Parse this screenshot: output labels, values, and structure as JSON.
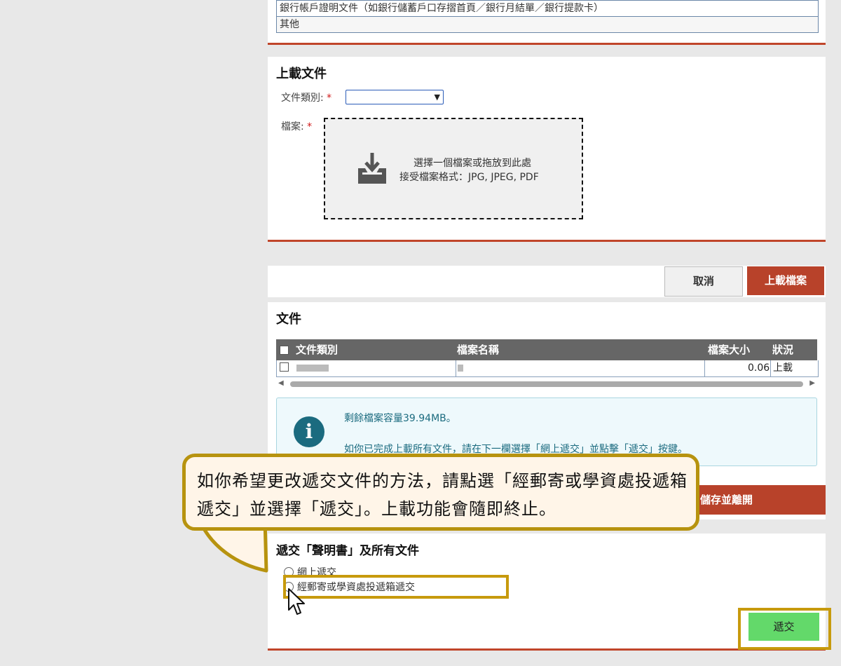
{
  "document_types": {
    "items": [
      "銀行帳戶證明文件（如銀行儲蓄戶口存摺首頁／銀行月結單／銀行提款卡）",
      "其他"
    ]
  },
  "upload": {
    "title": "上載文件",
    "type_label": "文件類別:",
    "file_label": "檔案:",
    "required_mark": "*",
    "drop_text": "選擇一個檔案或拖放到此處",
    "accept_text": "接受檔案格式：JPG, JPEG, PDF",
    "icon": "download-tray-icon"
  },
  "buttons": {
    "cancel": "取消",
    "upload": "上載檔案",
    "save_leave": "儲存並離開",
    "submit": "遞交"
  },
  "documents": {
    "title": "文件",
    "columns": [
      "文件類別",
      "檔案名稱",
      "檔案大小",
      "狀況"
    ],
    "rows": [
      {
        "type": "",
        "filename": "",
        "size": "0.06",
        "status": "上載"
      }
    ]
  },
  "info": {
    "icon": "info-icon",
    "line1": "剩餘檔案容量39.94MB。",
    "line2": "如你已完成上載所有文件，請在下一欄選擇「網上遞交」並點擊「遞交」按鍵。"
  },
  "submit_section": {
    "title": "遞交「聲明書」及所有文件",
    "options": [
      "網上遞交",
      "經郵寄或學資處投遞箱遞交"
    ]
  },
  "callout": {
    "text": "如你希望更改遞交文件的方法，請點選「經郵寄或學資處投遞箱遞交」並選擇「遞交」。上載功能會隨即終止。"
  },
  "colors": {
    "accent_red": "#b8422a",
    "highlight_gold": "#c79a0d",
    "submit_green": "#63d96a",
    "info_teal": "#1b6b7f"
  }
}
